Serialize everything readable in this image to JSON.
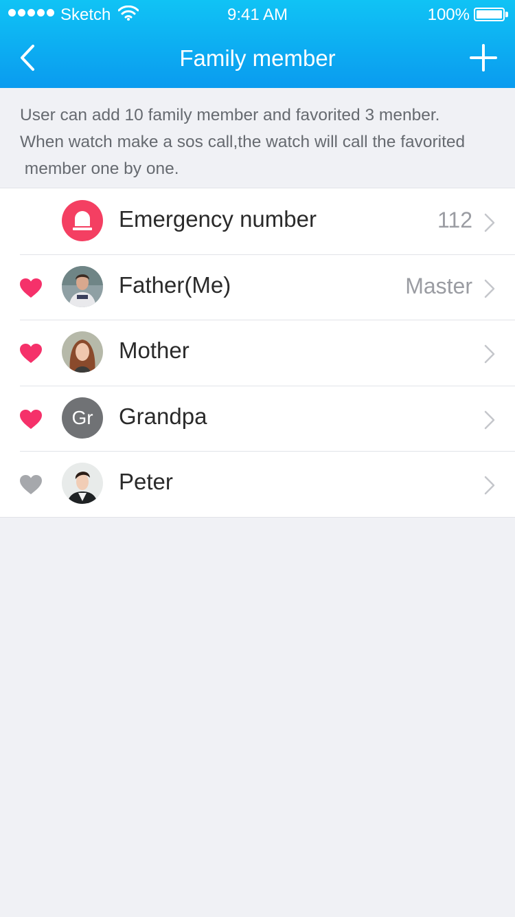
{
  "status_bar": {
    "carrier": "Sketch",
    "time": "9:41 AM",
    "battery": "100%"
  },
  "nav": {
    "title": "Family member",
    "back_icon": "chevron-left-icon",
    "add_icon": "plus-icon"
  },
  "notice": {
    "line1": "User can add 10 family member and favorited 3 menber.",
    "line2": "When watch make a sos call,the watch will call the favorited",
    "line3": " member one by one."
  },
  "members": [
    {
      "name": "Emergency number",
      "value": "112",
      "favorite": null,
      "avatar": "alarm-icon"
    },
    {
      "name": "Father(Me)",
      "value": "Master",
      "favorite": true,
      "avatar": "photo"
    },
    {
      "name": "Mother",
      "value": "",
      "favorite": true,
      "avatar": "photo"
    },
    {
      "name": "Grandpa",
      "value": "",
      "favorite": true,
      "avatar": "initials",
      "initials": "Gr"
    },
    {
      "name": "Peter",
      "value": "",
      "favorite": false,
      "avatar": "photo"
    }
  ],
  "colors": {
    "header_top": "#10c3f5",
    "header_bottom": "#0a9bef",
    "favorite": "#f5316a",
    "not_favorite": "#a6a8ac",
    "emergency": "#f43f62"
  }
}
